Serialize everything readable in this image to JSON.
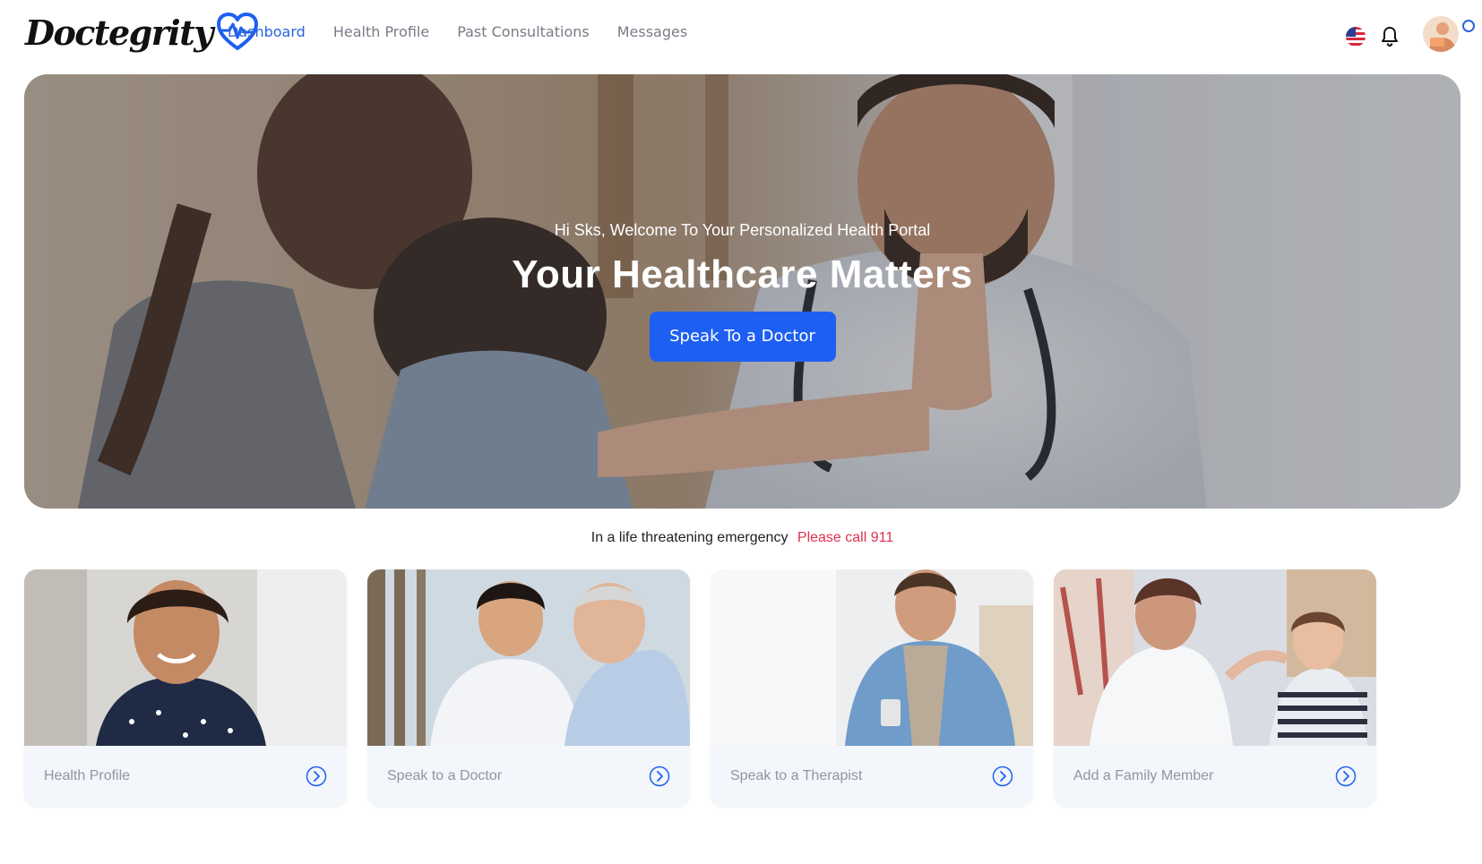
{
  "brand": {
    "name": "Doctegrity",
    "accent": "#1d5ff2",
    "alert": "#e0304e"
  },
  "nav": {
    "items": [
      {
        "label": "Dashboard",
        "active": true
      },
      {
        "label": "Health Profile",
        "active": false
      },
      {
        "label": "Past Consultations",
        "active": false
      },
      {
        "label": "Messages",
        "active": false
      }
    ]
  },
  "header": {
    "icons": [
      "us-flag-icon",
      "bell-icon",
      "avatar",
      "status-ring-icon"
    ]
  },
  "hero": {
    "greeting": "Hi Sks, Welcome To Your Personalized Health Portal",
    "title": "Your Healthcare Matters",
    "cta_label": "Speak To a Doctor"
  },
  "emergency": {
    "label": "In a life threatening emergency",
    "call": "Please call 911"
  },
  "cards": [
    {
      "label": "Health Profile",
      "icon": "arrow-right-circle-icon"
    },
    {
      "label": "Speak to a Doctor",
      "icon": "arrow-right-circle-icon"
    },
    {
      "label": "Speak to a Therapist",
      "icon": "arrow-right-circle-icon"
    },
    {
      "label": "Add a Family Member",
      "icon": "arrow-right-circle-icon"
    }
  ]
}
